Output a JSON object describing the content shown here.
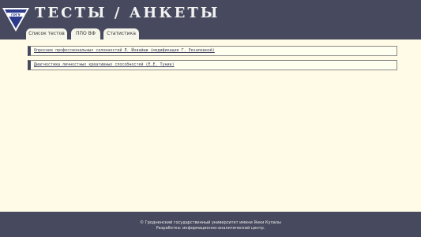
{
  "header": {
    "logo_text": "ГРГУ",
    "title": "ТЕСТЫ / АНКЕТЫ",
    "tabs": [
      {
        "label": "Список тестов"
      },
      {
        "label": "ППО ВФ"
      },
      {
        "label": "Статистика"
      }
    ]
  },
  "tests": [
    {
      "label": "Опросник профессиональных склонностей Л. Йовайши (модификация Г. Резапкиной)"
    },
    {
      "label": "Диагностика личностных креативных способностей (Е.Е. Туник)"
    }
  ],
  "footer": {
    "line1": "© Гродненский государственный университет имени Янки Купалы",
    "line2": "Разработка: информационно-аналитический центр."
  },
  "colors": {
    "header_bg": "#474a5e",
    "page_bg": "#fffbe6",
    "tab_bg": "#f5f5ea"
  }
}
